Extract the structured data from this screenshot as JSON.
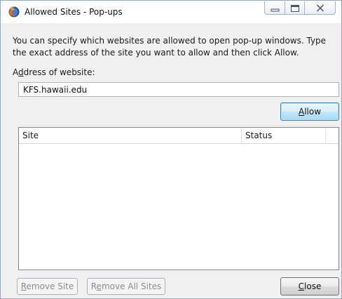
{
  "window": {
    "title": "Allowed Sites - Pop-ups"
  },
  "dialog": {
    "description": "You can specify which websites are allowed to open pop-up windows. Type the exact address of the site you want to allow and then click Allow.",
    "address_label_pre": "A",
    "address_label_accel": "d",
    "address_label_post": "dress of website:",
    "address_value": "KFS.hawaii.edu",
    "allow_accel": "A",
    "allow_rest": "llow"
  },
  "sites_list": {
    "columns": {
      "site": "Site",
      "status": "Status"
    },
    "rows": []
  },
  "footer": {
    "remove_site_accel": "R",
    "remove_site_rest": "emove Site",
    "remove_all_pre": "R",
    "remove_all_accel": "e",
    "remove_all_post": "move All Sites",
    "close_accel": "C",
    "close_rest": "lose"
  },
  "icons": {
    "app": "firefox-icon",
    "minimize": "minimize-icon",
    "maximize": "maximize-icon",
    "close": "close-icon"
  },
  "colors": {
    "window_border": "#9aa7b5",
    "client_bg": "#f0f0f0",
    "allow_button_border": "#3c7fb1",
    "disabled_text": "#8b8b8b"
  }
}
